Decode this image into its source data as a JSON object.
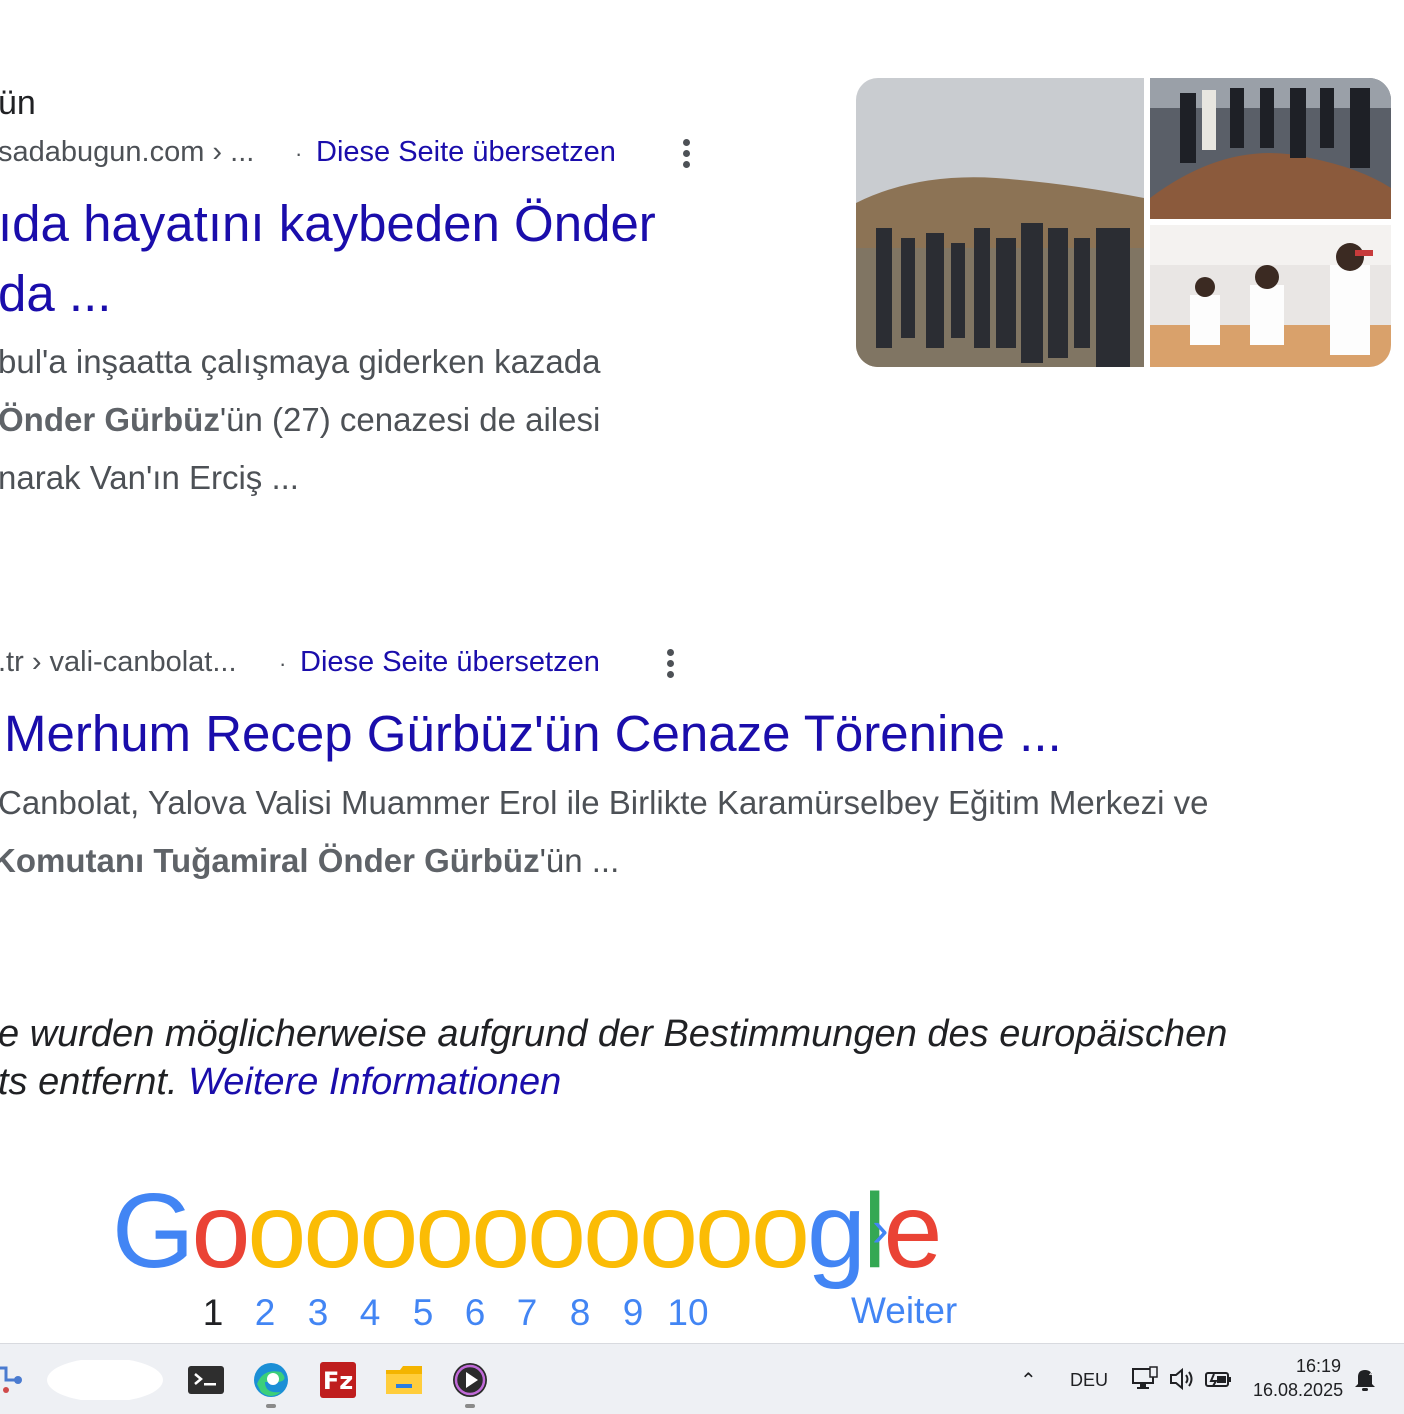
{
  "result1": {
    "title_fragment": "ün",
    "cite": "sadabugun.com › ...",
    "translate": "Diese Seite übersetzen",
    "title_line1": "ıda hayatını kaybeden Önder",
    "title_line2": "da ...",
    "snippet_line1": "bul'a inşaatta çalışmaya giderken kazada",
    "snippet_line2_bold": "Önder Gürbüz",
    "snippet_line2_rest": "'ün (27) cenazesi de ailesi",
    "snippet_line3": "narak Van'ın Erciş ..."
  },
  "result2": {
    "cite": ".tr › vali-canbolat...",
    "translate": "Diese Seite übersetzen",
    "title": "Merhum Recep Gürbüz'ün Cenaze Törenine ...",
    "snippet_line1": "Canbolat, Yalova Valisi Muammer Erol ile Birlikte Karamürselbey Eğitim Merkezi ve",
    "snippet_line2_bold": "Komutanı Tuğamiral Önder Gürbüz",
    "snippet_line2_rest": "'ün ..."
  },
  "notice": {
    "line1": "e wurden möglicherweise aufgrund der Bestimmungen des europäischen",
    "line2_text": "ts entfernt. ",
    "line2_link": "Weitere Informationen"
  },
  "pagination": {
    "logo_letters": [
      "G",
      "o",
      "o",
      "o",
      "o",
      "o",
      "o",
      "o",
      "o",
      "o",
      "o",
      "o",
      "g",
      "l",
      "e"
    ],
    "logo_colors": [
      "#4285f4",
      "#ea4335",
      "#fbbc05",
      "#fbbc05",
      "#fbbc05",
      "#fbbc05",
      "#fbbc05",
      "#fbbc05",
      "#fbbc05",
      "#fbbc05",
      "#fbbc05",
      "#fbbc05",
      "#4285f4",
      "#34a853",
      "#ea4335"
    ],
    "chevron": "›",
    "current": "1",
    "pages": [
      "2",
      "3",
      "4",
      "5",
      "6",
      "7",
      "8",
      "9",
      "10"
    ],
    "next_label": "Weiter"
  },
  "taskbar": {
    "apps": [
      "terminal-icon",
      "edge-icon",
      "filezilla-icon",
      "file-explorer-icon",
      "media-player-icon"
    ],
    "tray_chevron": "^",
    "language": "DEU",
    "time": "16:19",
    "date": "16.08.2025"
  },
  "colors": {
    "link": "#1a0dab",
    "pagination_blue": "#4285f4",
    "snippet_gray": "#4d5156"
  }
}
